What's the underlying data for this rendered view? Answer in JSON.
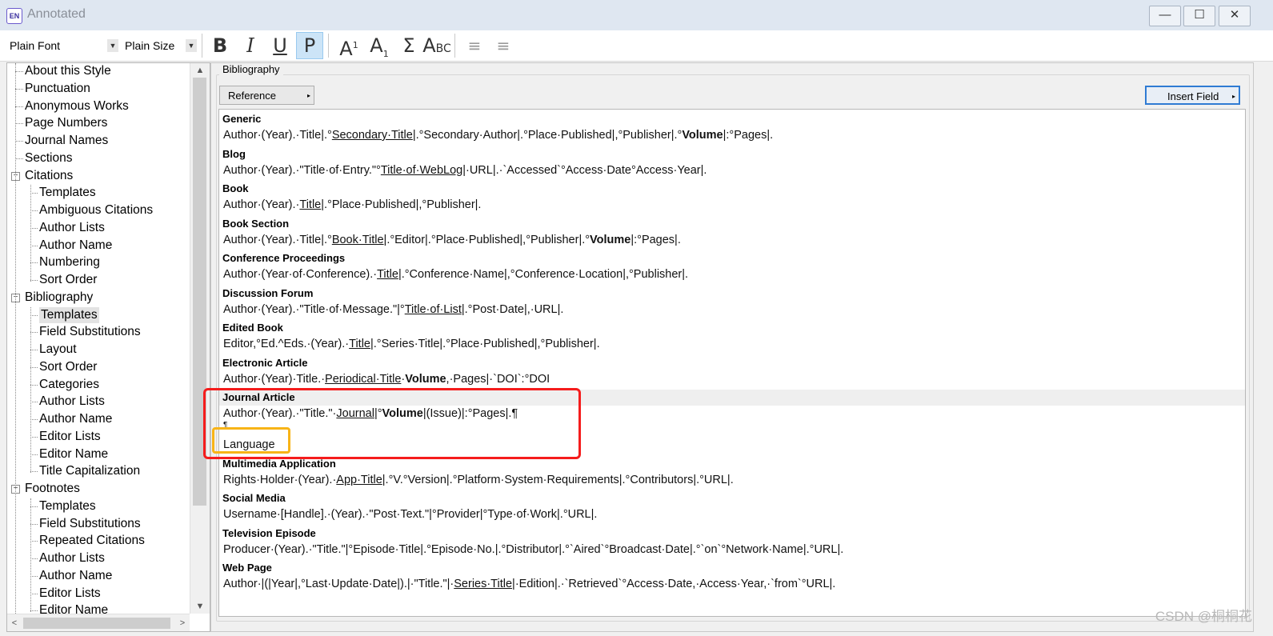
{
  "window": {
    "title": "Annotated",
    "app_icon_text": "EN",
    "minimize": "—",
    "maximize": "☐",
    "close": "✕"
  },
  "toolbar": {
    "font_combo": "Plain Font",
    "size_combo": "Plain Size",
    "bold": "B",
    "italic": "I",
    "underline": "U",
    "plain": "P",
    "superscript_base": "A",
    "superscript_mark": "1",
    "subscript_base": "A",
    "subscript_mark": "1",
    "symbol": "Σ",
    "small_caps_a": "A",
    "small_caps_bc": "BC",
    "align_left": "≡",
    "align_center": "≡"
  },
  "tree": {
    "items": [
      {
        "label": "About this Style",
        "level": 0
      },
      {
        "label": "Punctuation",
        "level": 0
      },
      {
        "label": "Anonymous Works",
        "level": 0
      },
      {
        "label": "Page Numbers",
        "level": 0
      },
      {
        "label": "Journal Names",
        "level": 0
      },
      {
        "label": "Sections",
        "level": 0
      },
      {
        "label": "Citations",
        "level": 0,
        "expander": "−"
      },
      {
        "label": "Templates",
        "level": 1
      },
      {
        "label": "Ambiguous Citations",
        "level": 1
      },
      {
        "label": "Author Lists",
        "level": 1
      },
      {
        "label": "Author Name",
        "level": 1
      },
      {
        "label": "Numbering",
        "level": 1
      },
      {
        "label": "Sort Order",
        "level": 1
      },
      {
        "label": "Bibliography",
        "level": 0,
        "expander": "−"
      },
      {
        "label": "Templates",
        "level": 1,
        "selected": true
      },
      {
        "label": "Field Substitutions",
        "level": 1
      },
      {
        "label": "Layout",
        "level": 1
      },
      {
        "label": "Sort Order",
        "level": 1
      },
      {
        "label": "Categories",
        "level": 1
      },
      {
        "label": "Author Lists",
        "level": 1
      },
      {
        "label": "Author Name",
        "level": 1
      },
      {
        "label": "Editor Lists",
        "level": 1
      },
      {
        "label": "Editor Name",
        "level": 1
      },
      {
        "label": "Title Capitalization",
        "level": 1
      },
      {
        "label": "Footnotes",
        "level": 0,
        "expander": "−"
      },
      {
        "label": "Templates",
        "level": 1
      },
      {
        "label": "Field Substitutions",
        "level": 1
      },
      {
        "label": "Repeated Citations",
        "level": 1
      },
      {
        "label": "Author Lists",
        "level": 1
      },
      {
        "label": "Author Name",
        "level": 1
      },
      {
        "label": "Editor Lists",
        "level": 1
      },
      {
        "label": "Editor Name",
        "level": 1
      }
    ],
    "scroll_up": "▲",
    "scroll_down": "▼",
    "scroll_left": "<",
    "scroll_right": ">"
  },
  "panel": {
    "group_label": "Bibliography",
    "reference_types_button": "Reference Types",
    "insert_field_button": "Insert Field",
    "caret": "▸"
  },
  "reference_types": [
    {
      "name": "Generic",
      "template_html": "Author·(Year).·Title|.°<u>Secondary·Title</u>|.°Secondary·Author|.°Place·Published|,°Publisher|.°<b>Volume</b>|:°Pages|."
    },
    {
      "name": "Blog",
      "template_html": "Author·(Year).·\"Title·of·Entry.\"°<u>Title·of·WebLog</u>|·URL|.·`Accessed`°Access·Date°Access·Year|."
    },
    {
      "name": "Book",
      "template_html": "Author·(Year).·<u>Title</u>|.°Place·Published|,°Publisher|."
    },
    {
      "name": "Book Section",
      "template_html": "Author·(Year).·Title|.°<u>Book·Title</u>|.°Editor|.°Place·Published|,°Publisher|.°<b>Volume</b>|:°Pages|."
    },
    {
      "name": "Conference Proceedings",
      "template_html": "Author·(Year·of·Conference).·<u>Title</u>|.°Conference·Name|,°Conference·Location|,°Publisher|."
    },
    {
      "name": "Discussion Forum",
      "template_html": "Author·(Year).·\"Title·of·Message.\"|°<u>Title·of·List</u>|.°Post·Date|,·URL|."
    },
    {
      "name": "Edited Book",
      "template_html": "Editor,°Ed.^Eds.·(Year).·<u>Title</u>|.°Series·Title|.°Place·Published|,°Publisher|."
    },
    {
      "name": "Electronic Article",
      "template_html": "Author·(Year)·Title.·<u>Periodical·Title</u>·<b>Volume</b>,·Pages|·`DOI`:°DOI"
    },
    {
      "name": "Journal Article",
      "template_html": "Author·(Year).·\"Title.\"·<u>Journal</u>|°<b>Volume</b>|(Issue)|:°Pages|.¶",
      "extra_line_mark": "¶",
      "extra_line_text": "Language",
      "highlighted": true
    },
    {
      "name": "Multimedia Application",
      "template_html": "Rights·Holder·(Year).·<u>App·Title</u>|.°V.°Version|.°Platform·System·Requirements|.°Contributors|.°URL|."
    },
    {
      "name": "Social Media",
      "template_html": "Username·[Handle].·(Year).·\"Post·Text.\"|°Provider|°Type·of·Work|.°URL|."
    },
    {
      "name": "Television Episode",
      "template_html": "Producer·(Year).·\"Title.\"|°Episode·Title|.°Episode·No.|.°Distributor|.°`Aired`°Broadcast·Date|.°`on`°Network·Name|.°URL|."
    },
    {
      "name": "Web Page",
      "template_html": "Author·|(|Year|,°Last·Update·Date|).|·\"Title.\"|·<u>Series·Title</u>|·Edition|.·`Retrieved`°Access·Date,·Access·Year,·`from`°URL|."
    }
  ],
  "annotations": {
    "red_box": "#f51c1c",
    "yellow_box": "#f8b417"
  },
  "watermark": "CSDN @桐桐花"
}
